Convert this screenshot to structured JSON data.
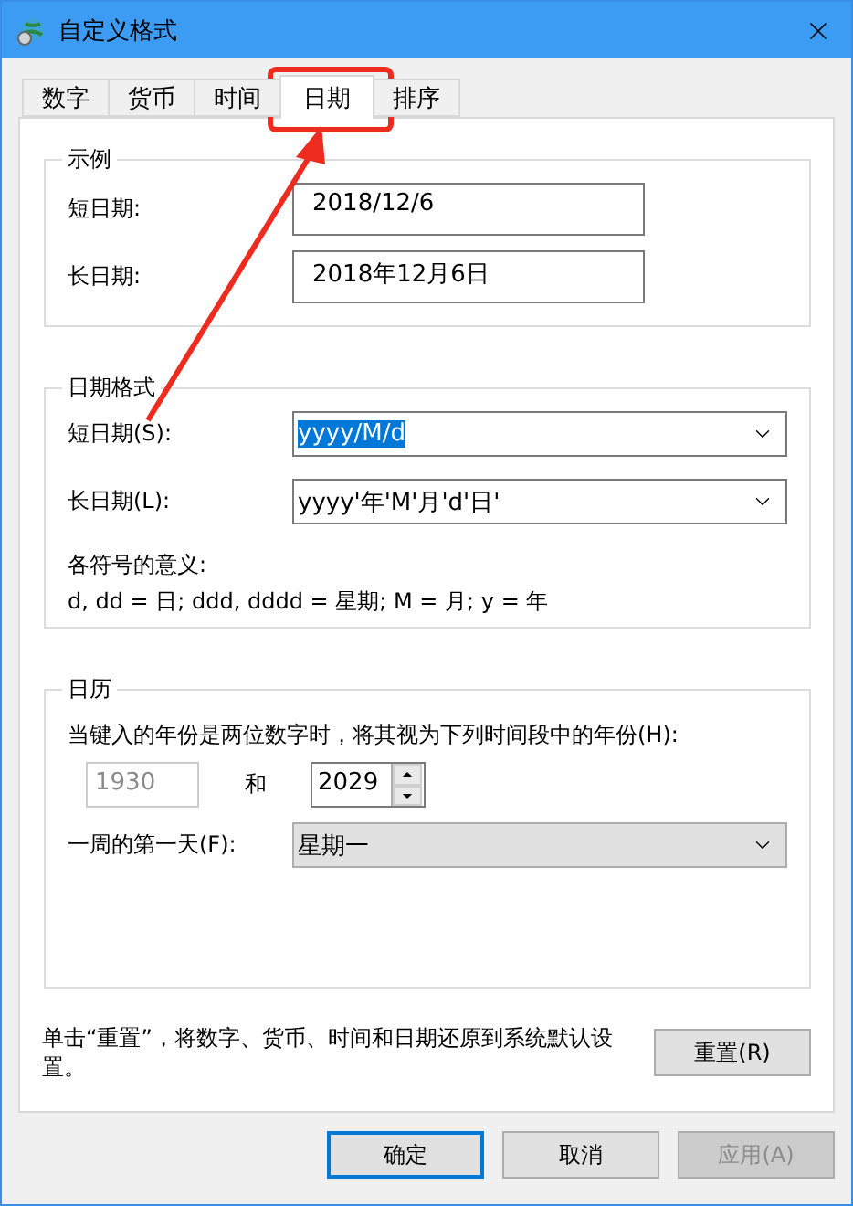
{
  "window": {
    "title": "自定义格式"
  },
  "tabs": [
    {
      "label": "数字",
      "selected": false
    },
    {
      "label": "货币",
      "selected": false
    },
    {
      "label": "时间",
      "selected": false
    },
    {
      "label": "日期",
      "selected": true
    },
    {
      "label": "排序",
      "selected": false
    }
  ],
  "example": {
    "title": "示例",
    "rows": [
      {
        "label": "短日期:",
        "value": "2018/12/6"
      },
      {
        "label": "长日期:",
        "value": "2018年12月6日"
      }
    ]
  },
  "date_format": {
    "title": "日期格式",
    "rows": [
      {
        "label": "短日期(S):",
        "value": "yyyy/M/d",
        "highlighted": true
      },
      {
        "label": "长日期(L):",
        "value": "yyyy'年'M'月'd'日'",
        "highlighted": false
      }
    ],
    "legend_title": "各符号的意义:",
    "legend": "d, dd = 日;  ddd, dddd = 星期;  M = 月;  y = 年"
  },
  "calendar": {
    "title": "日历",
    "description": "当键入的年份是两位数字时，将其视为下列时间段中的年份(H):",
    "from_year": {
      "value": "1930",
      "disabled": true
    },
    "and": "和",
    "to_year": {
      "value": "2029",
      "disabled": false
    },
    "first_day": {
      "label": "一周的第一天(F):",
      "value": "星期一"
    }
  },
  "reset": {
    "note": "单击“重置”，将数字、货币、时间和日期还原到系统默认设置。",
    "button": "重置(R)"
  },
  "buttons": [
    {
      "label": "确定",
      "default": true,
      "disabled": false
    },
    {
      "label": "取消",
      "default": false,
      "disabled": false
    },
    {
      "label": "应用(A)",
      "default": false,
      "disabled": true
    }
  ]
}
